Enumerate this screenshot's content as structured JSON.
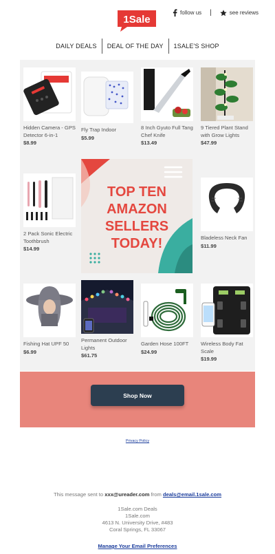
{
  "header": {
    "logo_text": "1Sale",
    "follow_label": "follow us",
    "separator": "|",
    "reviews_label": "see reviews"
  },
  "nav": {
    "items": [
      "DAILY DEALS",
      "DEAL OF THE DAY",
      "1SALE'S SHOP"
    ]
  },
  "products": [
    {
      "name": "Hidden Camera - GPS Detector 6-in-1",
      "price": "$8.99"
    },
    {
      "name": "Fly Trap Indoor",
      "price": "$5.99"
    },
    {
      "name": "8 Inch Gyuto Full Tang Chef Knife",
      "price": "$13.49"
    },
    {
      "name": "9 Tiered Plant Stand with Grow Lights",
      "price": "$47.99"
    },
    {
      "name": "2 Pack Sonic Electric Toothbrush",
      "price": "$14.99"
    },
    {
      "name": "Bladeless Neck Fan",
      "price": "$11.99"
    },
    {
      "name": "Fishing Hat UPF 50",
      "price": "$6.99"
    },
    {
      "name": "Permanent Outdoor Lights",
      "price": "$61.75"
    },
    {
      "name": "Garden Hose 100FT",
      "price": "$24.99"
    },
    {
      "name": "Wireless Body Fat Scale",
      "price": "$19.99"
    }
  ],
  "hero": {
    "line1": "TOP TEN",
    "line2": "AMAZON",
    "line3": "SELLERS",
    "line4": "TODAY!"
  },
  "cta": {
    "label": "Shop Now"
  },
  "privacy": {
    "label": "Privacy Policy"
  },
  "footer": {
    "sent_prefix": "This message sent to",
    "recipient": "xxx@ureader.com",
    "from_word": "from",
    "sender": "deals@email.1sale.com",
    "company_line1": "1Sale.com Deals",
    "company_line2": "1Sale.com",
    "street": "4613 N. University Drive, #483",
    "city": "Coral Springs, FL 33067",
    "prefs_label": "Manage Your Email Preferences"
  },
  "colors": {
    "brand_red": "#e53935",
    "cta_band": "#e8857b",
    "cta_button": "#2c3e50",
    "hero_text": "#e4473f",
    "hero_teal": "#3aaea0"
  }
}
